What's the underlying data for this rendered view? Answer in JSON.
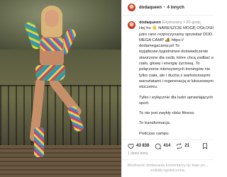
{
  "header": {
    "username": "dodaqueen",
    "separator": "•",
    "others": "4 innych"
  },
  "caption": {
    "username": "dodaqueen",
    "edited": "Edytowany • 20 godz.",
    "lines": [
      "Hej ho 👋 NARESZCIE MOGĘ OGŁOSIĆ J...",
      "jutro rano rozpoczynamy sprzedaż DOD...",
      "MEGA CAMP 🏕️ https://",
      "dodamegacamp.pl/ To",
      "wyjątkowe,tygodniowe doświadczenie",
      "stworzone dla osób, które chcą zadbać o",
      "ciało, głowę i energię życiową. To",
      "połączenie intensywnych treningów nie",
      "tylko ciała, ale i ducha z wartościowymi",
      "warsztatami i regeneracją w luksusowym",
      "otoczeniu."
    ],
    "para2": "Tylko i wyłącznie dla ludzi uprawiających",
    "para2b": "sport.",
    "para3": "To nie jest zwykły obóz fitness.",
    "para4": "To transformacja.",
    "para5": "Podczas campu:"
  },
  "actions": {
    "likes": "43 838",
    "comments": "414",
    "reposts": "21"
  },
  "date": "1 dzień temu",
  "comment_box": {
    "line1": "Możliwość dodawania komentarzy do tego po...",
    "line2": "została ograniczona."
  }
}
